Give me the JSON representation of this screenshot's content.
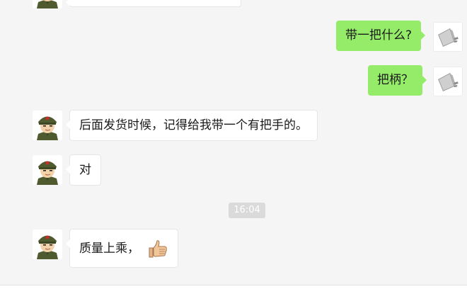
{
  "messages": [
    {
      "side": "right",
      "text": "带一把什么?"
    },
    {
      "side": "right",
      "text": "把柄？"
    },
    {
      "side": "left",
      "text": "后面发货时候，记得给我带一个有把手的。"
    },
    {
      "side": "left",
      "text": "对"
    },
    {
      "side": "left",
      "text": "质量上乘，",
      "emoji": "thumbs-up-icon"
    }
  ],
  "timestamp": "16:04",
  "colors": {
    "background": "#f5f5f5",
    "outgoing_bubble": "#95ec69",
    "incoming_bubble": "#ffffff",
    "timestamp_bg": "#dadada"
  },
  "avatars": {
    "contact": "soldier-avatar",
    "self": "plug-device-avatar"
  }
}
